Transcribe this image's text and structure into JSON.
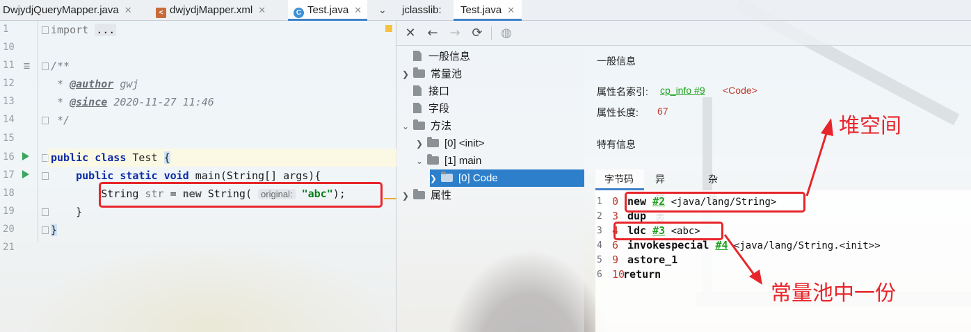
{
  "editor": {
    "tabs": [
      {
        "label": "DwjydjQueryMapper.java"
      },
      {
        "label": "dwjydjMapper.xml"
      },
      {
        "label": "Test.java"
      }
    ],
    "lines": [
      {
        "n": "1",
        "text": "import ..."
      },
      {
        "n": "10",
        "text": ""
      },
      {
        "n": "11",
        "text": "/**"
      },
      {
        "n": "12",
        "text": " * @author gwj"
      },
      {
        "n": "13",
        "text": " * @since 2020-11-27 11:46"
      },
      {
        "n": "14",
        "text": " */"
      },
      {
        "n": "15",
        "text": ""
      },
      {
        "n": "16",
        "text": "public class Test {"
      },
      {
        "n": "17",
        "text": "    public static void main(String[] args){"
      },
      {
        "n": "18",
        "text": "        String str = new String( original: \"abc\");"
      },
      {
        "n": "19",
        "text": "    }"
      },
      {
        "n": "20",
        "text": "}"
      },
      {
        "n": "21",
        "text": ""
      }
    ],
    "tokens": {
      "import": "import",
      "ellipsis": "...",
      "doc_open": "/**",
      "star": "*",
      "author_tag": "@author",
      "author": "gwj",
      "since_tag": "@since",
      "since": "2020-11-27 11:46",
      "doc_close": "*/",
      "public": "public",
      "class": "class",
      "class_name": "Test",
      "brace_open": "{",
      "static": "static",
      "void": "void",
      "main_sig": "main(String[] args){",
      "string_type": "String",
      "var": "str",
      "eq": "=",
      "new": "new",
      "ctor": "String(",
      "hint": "original:",
      "literal": "\"abc\"",
      "close": ");",
      "brace_close": "}"
    }
  },
  "jclasslib": {
    "tab_prefix": "jclasslib:",
    "tab_label": "Test.java",
    "tree": [
      {
        "label": "一般信息"
      },
      {
        "label": "常量池"
      },
      {
        "label": "接口"
      },
      {
        "label": "字段"
      },
      {
        "label": "方法"
      },
      {
        "label": "[0] <init>"
      },
      {
        "label": "[1] main"
      },
      {
        "label": "[0] Code"
      },
      {
        "label": "属性"
      }
    ],
    "general_title": "一般信息",
    "attr_name_label": "属性名索引:",
    "attr_name_ref": "cp_info #9",
    "attr_name_value": "<Code>",
    "attr_len_label": "属性长度:",
    "attr_len_value": "67",
    "specific_title": "特有信息",
    "sub_tabs": [
      "字节码",
      "异常表",
      "杂项"
    ],
    "bytecode": [
      {
        "ln": "1",
        "off": "0",
        "op": "new",
        "ref": "#2",
        "arg": " <java/lang/String>"
      },
      {
        "ln": "2",
        "off": "3",
        "op": "dup",
        "ref": "",
        "arg": ""
      },
      {
        "ln": "3",
        "off": "4",
        "op": "ldc",
        "ref": "#3",
        "arg": " <abc>"
      },
      {
        "ln": "4",
        "off": "6",
        "op": "invokespecial",
        "ref": "#4",
        "arg": " <java/lang/String.<init>>"
      },
      {
        "ln": "5",
        "off": "9",
        "op": "astore_1",
        "ref": "",
        "arg": ""
      },
      {
        "ln": "6",
        "off": "10",
        "op": "return",
        "ref": "",
        "arg": ""
      }
    ]
  },
  "annotations": {
    "heap": "堆空间",
    "pool": "常量池中一份"
  },
  "colors": {
    "accent": "#4083c9",
    "annotation_red": "#e8252a",
    "keyword": "#0a2aa6",
    "string": "#067d17",
    "cp_ref": "#21a11e",
    "selection": "#2d7fcb"
  }
}
